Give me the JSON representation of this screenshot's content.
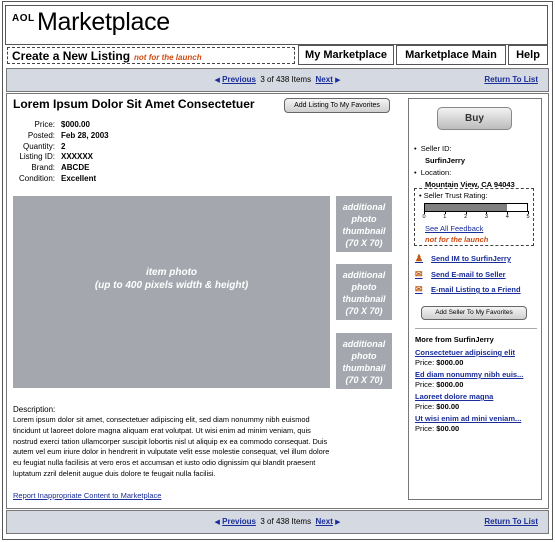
{
  "header": {
    "brand_small": "AOL",
    "brand_title": "Marketplace"
  },
  "top_nav": {
    "create_label": "Create a New Listing",
    "create_note": "not for the launch",
    "my_marketplace": "My Marketplace",
    "marketplace_main": "Marketplace Main",
    "help": "Help"
  },
  "pager": {
    "previous": "Previous",
    "position": "3 of 438 Items",
    "next": "Next",
    "return": "Return To List"
  },
  "listing": {
    "title": "Lorem Ipsum Dolor Sit Amet Consectetuer",
    "fav_button": "Add Listing To My Favorites",
    "details": [
      {
        "label": "Price:",
        "value": "$000.00"
      },
      {
        "label": "Posted:",
        "value": "Feb 28, 2003"
      },
      {
        "label": "Quantity:",
        "value": "2"
      },
      {
        "label": "Listing ID:",
        "value": "XXXXXX"
      },
      {
        "label": "Brand:",
        "value": "ABCDE"
      },
      {
        "label": "Condition:",
        "value": "Excellent"
      }
    ],
    "photo_line1": "item photo",
    "photo_line2": "(up to 400 pixels width & height)",
    "thumb_lines": [
      "additional",
      "photo",
      "thumbnail",
      "(70 X 70)"
    ],
    "description_label": "Description:",
    "description": "Lorem ipsum dolor sit amet, consectetuer adipiscing elit, sed diam nonummy nibh euismod tincidunt ut laoreet dolore magna aliquam erat volutpat. Ut wisi enim ad minim veniam, quis nostrud exerci tation ullamcorper suscipit lobortis nisl ut aliquip ex ea commodo consequat. Duis autem vel eum iriure dolor in hendrerit in vulputate velit esse molestie consequat, vel illum dolore eu feugiat nulla facilisis at vero eros et accumsan et iusto odio dignissim qui blandit praesent luptatum zzril delenit augue duis dolore te feugait nulla facilisi.",
    "report_link": "Report Inappropriate Content to Marketplace"
  },
  "seller": {
    "buy": "Buy",
    "id_label": "Seller ID:",
    "id_value": "SurfinJerry",
    "location_label": "Location:",
    "location_value": "Mountain View, CA 94043",
    "trust_label": "Seller Trust Rating:",
    "trust_ticks": [
      "0",
      "1",
      "2",
      "3",
      "4",
      "5"
    ],
    "trust_rating_fraction": 0.8,
    "see_feedback": "See All Feedback",
    "trust_note": "not for the launch",
    "send_im": "Send IM to SurfinJerry",
    "send_email": "Send E-mail to Seller",
    "email_friend": "E-mail Listing to a Friend",
    "add_seller": "Add Seller To My Favorites",
    "more_header": "More from SurfinJerry",
    "more_items": [
      {
        "title": "Consectetuer adipiscing elit",
        "price_label": "Price:",
        "price": "$000.00"
      },
      {
        "title": "Ed diam nonummy nibh euis...",
        "price_label": "Price:",
        "price": "$000.00"
      },
      {
        "title": "Laoreet dolore magna",
        "price_label": "Price:",
        "price": "$00.00"
      },
      {
        "title": "Ut wisi enim ad mini veniam...",
        "price_label": "Price:",
        "price": "$00.00"
      }
    ]
  },
  "colors": {
    "link": "#1a2d9a",
    "note": "#d14a12",
    "placeholder": "#a4a8ae",
    "pager_bg": "#d5d9e1"
  },
  "icons": {
    "im": "person-icon",
    "email": "envelope-icon",
    "friend": "envelope-icon"
  }
}
